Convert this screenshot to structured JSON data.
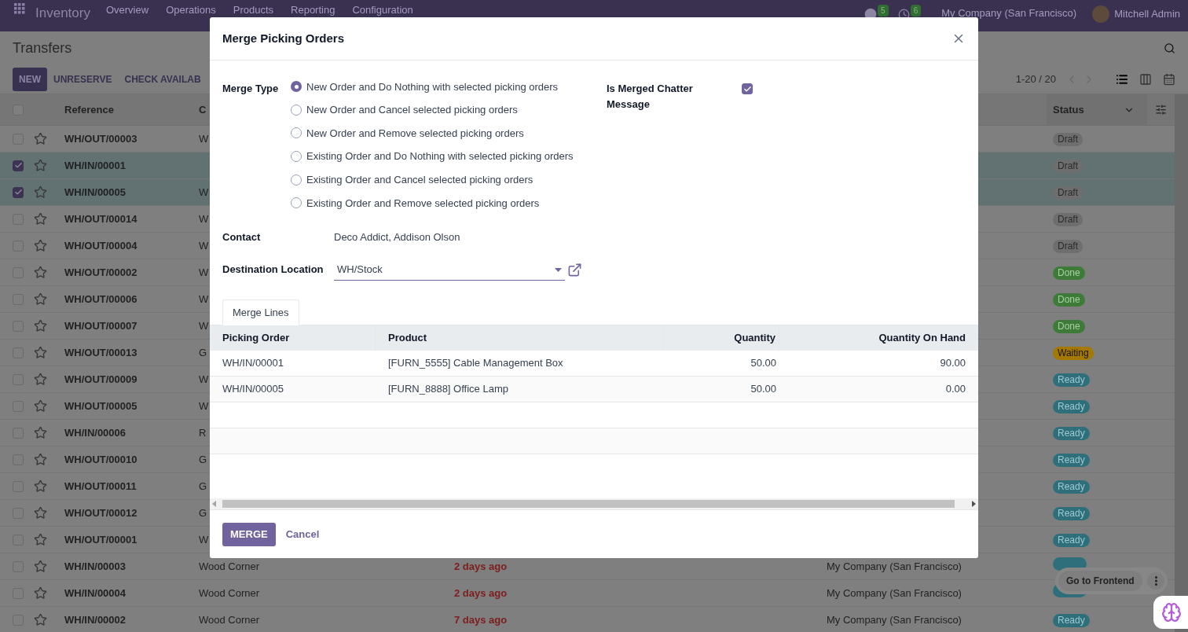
{
  "navbar": {
    "app": "Inventory",
    "menu": [
      "Overview",
      "Operations",
      "Products",
      "Reporting",
      "Configuration"
    ],
    "messages_badge": "5",
    "activities_badge": "6",
    "company": "My Company (San Francisco)",
    "user": "Mitchell Admin"
  },
  "control_panel": {
    "title": "Transfers",
    "buttons": [
      {
        "label": "NEW",
        "kind": "primary"
      },
      {
        "label": "UNRESERVE",
        "kind": "secondary"
      },
      {
        "label": "CHECK AVAILAB",
        "kind": "secondary"
      }
    ],
    "pager": "1-20 / 20",
    "views": [
      {
        "kind": "list",
        "selected": true
      },
      {
        "kind": "kanban",
        "selected": false
      },
      {
        "kind": "calendar",
        "selected": false
      }
    ]
  },
  "list": {
    "all_checked": false,
    "columns": {
      "reference": "Reference",
      "contact": "C",
      "status": "Status"
    },
    "rows": [
      {
        "reference": "WH/OUT/00003",
        "contact": "W",
        "status": {
          "label": "Draft",
          "kind": "draft"
        },
        "checked": false
      },
      {
        "reference": "WH/IN/00001",
        "status": {
          "label": "Draft",
          "kind": "draft"
        },
        "checked": true
      },
      {
        "reference": "WH/IN/00005",
        "contact": "W",
        "status": {
          "label": "Draft",
          "kind": "draft"
        },
        "checked": true
      },
      {
        "reference": "WH/OUT/00014",
        "contact": "W",
        "status": {
          "label": "Draft",
          "kind": "draft"
        },
        "checked": false
      },
      {
        "reference": "WH/OUT/00004",
        "contact": "W",
        "status": {
          "label": "Draft",
          "kind": "draft"
        },
        "checked": false
      },
      {
        "reference": "WH/OUT/00002",
        "contact": "W",
        "status": {
          "label": "Done",
          "kind": "done"
        },
        "checked": false
      },
      {
        "reference": "WH/OUT/00006",
        "contact": "W",
        "status": {
          "label": "Done",
          "kind": "done"
        },
        "checked": false
      },
      {
        "reference": "WH/OUT/00007",
        "contact": "W",
        "status": {
          "label": "Done",
          "kind": "done"
        },
        "checked": false
      },
      {
        "reference": "WH/OUT/00013",
        "contact": "G",
        "status": {
          "label": "Waiting",
          "kind": "waiting"
        },
        "checked": false
      },
      {
        "reference": "WH/OUT/00009",
        "contact": "W",
        "status": {
          "label": "Ready",
          "kind": "ready"
        },
        "checked": false
      },
      {
        "reference": "WH/OUT/00005",
        "contact": "W",
        "status": {
          "label": "Ready",
          "kind": "ready"
        },
        "checked": false
      },
      {
        "reference": "WH/IN/00006",
        "contact": "R",
        "status": {
          "label": "Ready",
          "kind": "ready"
        },
        "checked": false
      },
      {
        "reference": "WH/OUT/00010",
        "contact": "G",
        "status": {
          "label": "Ready",
          "kind": "ready"
        },
        "checked": false
      },
      {
        "reference": "WH/OUT/00011",
        "contact": "G",
        "status": {
          "label": "Ready",
          "kind": "ready"
        },
        "checked": false
      },
      {
        "reference": "WH/OUT/00012",
        "contact": "G",
        "status": {
          "label": "Ready",
          "kind": "ready"
        },
        "checked": false
      },
      {
        "reference": "WH/OUT/00001",
        "contact": "W",
        "status": {
          "label": "Ready",
          "kind": "ready"
        },
        "checked": false
      },
      {
        "reference": "WH/IN/00003",
        "contact": "Wood Corner",
        "date": "2 days ago",
        "company": "My Company (San Francisco)",
        "status": {
          "kind": "ready"
        },
        "checked": false
      },
      {
        "reference": "WH/IN/00004",
        "contact": "Wood Corner",
        "date": "2 days ago",
        "company": "My Company (San Francisco)",
        "status": {
          "kind": "ready"
        },
        "checked": false
      },
      {
        "reference": "WH/IN/00002",
        "contact": "Wood Corner",
        "date": "7 days ago",
        "company": "My Company (San Francisco)",
        "status": {
          "label": "Ready",
          "kind": "ready"
        },
        "checked": false
      }
    ]
  },
  "modal": {
    "title": "Merge Picking Orders",
    "merge_type": {
      "label": "Merge Type",
      "options": [
        {
          "label": "New Order and Do Nothing with selected picking orders",
          "selected": true
        },
        {
          "label": "New Order and Cancel selected picking orders",
          "selected": false
        },
        {
          "label": "New Order and Remove selected picking orders",
          "selected": false
        },
        {
          "label": "Existing Order and Do Nothing with selected picking orders",
          "selected": false
        },
        {
          "label": "Existing Order and Cancel selected picking orders",
          "selected": false
        },
        {
          "label": "Existing Order and Remove selected picking orders",
          "selected": false
        }
      ]
    },
    "chatter": {
      "label": "Is Merged Chatter Message",
      "checked": true
    },
    "contact": {
      "label": "Contact",
      "value": "Deco Addict, Addison Olson"
    },
    "destination": {
      "label": "Destination Location",
      "value": "WH/Stock"
    },
    "tabs": [
      {
        "label": "Merge Lines",
        "selected": true
      }
    ],
    "lines": {
      "columns": [
        "Picking Order",
        "Product",
        "Quantity",
        "Quantity On Hand"
      ],
      "rows": [
        [
          "WH/IN/00001",
          "[FURN_5555] Cable Management Box",
          "50.00",
          "90.00"
        ],
        [
          "WH/IN/00005",
          "[FURN_8888] Office Lamp",
          "50.00",
          "0.00"
        ]
      ]
    },
    "buttons": [
      {
        "label": "MERGE",
        "kind": "primary"
      },
      {
        "label": "Cancel",
        "kind": "link"
      }
    ]
  },
  "floating": {
    "label": "Go to Frontend"
  }
}
